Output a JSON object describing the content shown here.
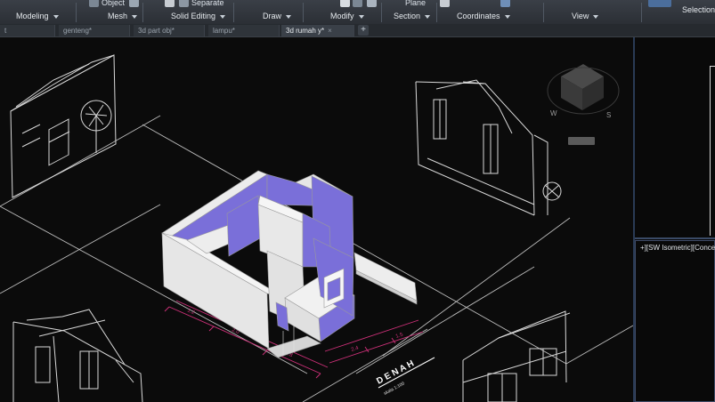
{
  "ribbon": {
    "top_items": {
      "object": "Object",
      "separate": "Separate",
      "plane": "Plane",
      "selection": "Selection"
    },
    "panels": {
      "modeling": "Modeling",
      "mesh": "Mesh",
      "solid_editing": "Solid Editing",
      "draw": "Draw",
      "modify": "Modify",
      "section": "Section",
      "coordinates": "Coordinates",
      "view": "View",
      "selection": "Selection"
    }
  },
  "file_tabs": [
    {
      "label": "t",
      "active": false
    },
    {
      "label": "genteng*",
      "active": false
    },
    {
      "label": "3d part obj*",
      "active": false
    },
    {
      "label": "lampu*",
      "active": false
    },
    {
      "label": "3d rumah y*",
      "active": true
    }
  ],
  "new_tab_label": "+",
  "viewcube": {
    "left": "W",
    "front": "S"
  },
  "drawing": {
    "title": "D E N A H",
    "scale": "skala 1:100"
  },
  "right_viewport": {
    "label": "+][SW Isometric][Conce"
  },
  "colors": {
    "accent_wall": "#7a6fd9",
    "wall": "#e6e6e6",
    "dim": "#d0307a",
    "line": "#d8d8d8"
  }
}
